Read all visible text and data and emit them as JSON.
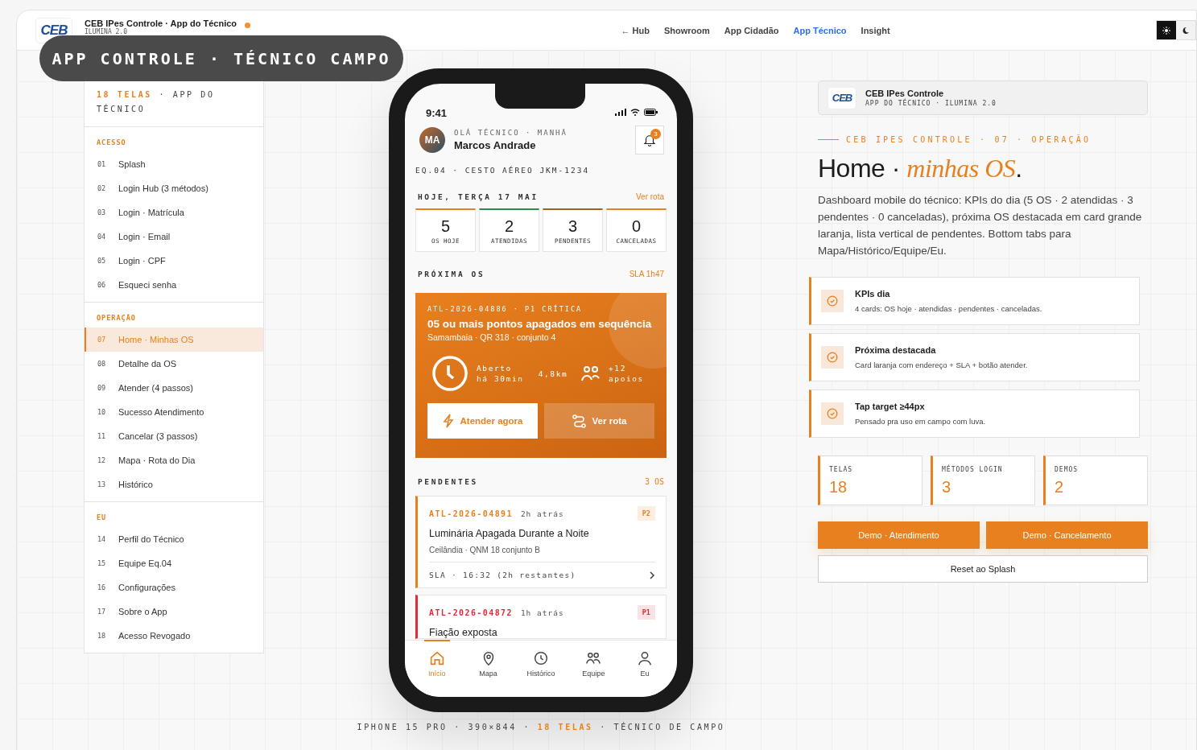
{
  "topbar": {
    "logo_text": "CEB",
    "title": "CEB IPes Controle · App do Técnico",
    "subtitle": "ILUMINA 2.0",
    "nav": [
      {
        "label": "← Hub",
        "selected": false
      },
      {
        "label": "Showroom",
        "selected": false
      },
      {
        "label": "App Cidadão",
        "selected": false
      },
      {
        "label": "App Técnico",
        "selected": true
      },
      {
        "label": "Insight",
        "selected": false
      }
    ],
    "theme_toggle": [
      {
        "kind": "light",
        "selected": true
      },
      {
        "kind": "dark",
        "selected": false
      }
    ]
  },
  "overlay_label": "APP CONTROLE · TÉCNICO CAMPO",
  "sidebar": {
    "heading": "**18 TELAS** · APP DO TÉCNICO",
    "groups": [
      {
        "title": "ACESSO",
        "items": [
          {
            "number": "01",
            "label": "Splash",
            "selected": false
          },
          {
            "number": "02",
            "label": "Login Hub (3 métodos)",
            "selected": false
          },
          {
            "number": "03",
            "label": "Login · Matrícula",
            "selected": false
          },
          {
            "number": "04",
            "label": "Login · Email",
            "selected": false
          },
          {
            "number": "05",
            "label": "Login · CPF",
            "selected": false
          },
          {
            "number": "06",
            "label": "Esqueci senha",
            "selected": false
          }
        ]
      },
      {
        "title": "OPERAÇÃO",
        "items": [
          {
            "number": "07",
            "label": "Home · Minhas OS",
            "selected": true
          },
          {
            "number": "08",
            "label": "Detalhe da OS",
            "selected": false
          },
          {
            "number": "09",
            "label": "Atender (4 passos)",
            "selected": false
          },
          {
            "number": "10",
            "label": "Sucesso Atendimento",
            "selected": false
          },
          {
            "number": "11",
            "label": "Cancelar (3 passos)",
            "selected": false
          },
          {
            "number": "12",
            "label": "Mapa · Rota do Dia",
            "selected": false
          },
          {
            "number": "13",
            "label": "Histórico",
            "selected": false
          }
        ]
      },
      {
        "title": "EU",
        "items": [
          {
            "number": "14",
            "label": "Perfil do Técnico",
            "selected": false
          },
          {
            "number": "15",
            "label": "Equipe Eq.04",
            "selected": false
          },
          {
            "number": "16",
            "label": "Configurações",
            "selected": false
          },
          {
            "number": "17",
            "label": "Sobre o App",
            "selected": false
          },
          {
            "number": "18",
            "label": "Acesso Revogado",
            "selected": false
          }
        ]
      }
    ]
  },
  "phone": {
    "time": "9:41",
    "avatar": "MA",
    "greeting": "OLÁ TÉCNICO · MANHÃ",
    "name": "Marcos Andrade",
    "notifications": "3",
    "team": "EQ.04 · CESTO AÉREO JKM-1234",
    "today": "HOJE, TERÇA 17 MAI",
    "today_link": "Ver rota",
    "kpis": [
      {
        "value": "5",
        "label": "OS HOJE",
        "color": "#e8801f"
      },
      {
        "value": "2",
        "label": "ATENDIDAS",
        "color": "#2f8a4e"
      },
      {
        "value": "3",
        "label": "PENDENTES",
        "color": "#9a6420"
      },
      {
        "value": "0",
        "label": "CANCELADAS",
        "color": "#e8801f"
      }
    ],
    "next_label": "PRÓXIMA OS",
    "next_sla": "SLA 1h47",
    "next": {
      "code": "ATL-2026-04886 · P1 CRÍTICA",
      "title": "05 ou mais pontos apagados em sequência",
      "address": "Samambaia · QR 318 · conjunto 4",
      "open": "Aberto há 30min",
      "distance": "4,8km",
      "support": "+12 apoios",
      "primary": "Atender agora",
      "secondary": "Ver rota"
    },
    "pending_label": "PENDENTES",
    "pending_count": "3 OS",
    "pending": [
      {
        "code": "ATL-2026-04891",
        "time": "2h atrás",
        "priority": "P2",
        "color": "#e8801f",
        "title": "Luminária Apagada Durante a Noite",
        "address": "Ceilândia · QNM 18 conjunto B",
        "sla": "SLA · 16:32 (2h restantes)"
      },
      {
        "code": "ATL-2026-04872",
        "time": "1h atrás",
        "priority": "P1",
        "color": "#d92d3a",
        "title": "Fiação exposta"
      }
    ],
    "tabs": [
      {
        "kind": "home",
        "label": "Início",
        "selected": true
      },
      {
        "kind": "map",
        "label": "Mapa",
        "selected": false
      },
      {
        "kind": "history",
        "label": "Histórico",
        "selected": false
      },
      {
        "kind": "team",
        "label": "Equipe",
        "selected": false
      },
      {
        "kind": "me",
        "label": "Eu",
        "selected": false
      }
    ]
  },
  "caption": "IPHONE 15 PRO · 390×844 · **18 TELAS** · TÉCNICO DE CAMPO",
  "detail": {
    "brand": {
      "logo_text": "CEB",
      "title": "CEB IPes Controle",
      "subtitle": "APP DO TÉCNICO · ILUMINA 2.0"
    },
    "eyebrow": "CEB IPES CONTROLE · 07 · OPERAÇÃO",
    "title": "Home · *minhas OS*.",
    "description": "Dashboard mobile do técnico: KPIs do dia (5 OS · 2 atendidas · 3 pendentes · 0 canceladas), próxima OS destacada em card grande laranja, lista vertical de pendentes. Bottom tabs para Mapa/Histórico/Equipe/Eu.",
    "features": [
      {
        "title": "KPIs dia",
        "text": "4 cards: OS hoje · atendidas · pendentes · canceladas."
      },
      {
        "title": "Próxima destacada",
        "text": "Card laranja com endereço + SLA + botão atender."
      },
      {
        "title": "Tap target ≥44px",
        "text": "Pensado pra uso em campo com luva."
      }
    ],
    "stats": [
      {
        "label": "TELAS",
        "value": "18"
      },
      {
        "label": "MÉTODOS LOGIN",
        "value": "3"
      },
      {
        "label": "DEMOS",
        "value": "2"
      }
    ],
    "buttons": [
      {
        "kind": "primary",
        "label": "Demo · Atendimento"
      },
      {
        "kind": "primary",
        "label": "Demo · Cancelamento"
      },
      {
        "kind": "secondary",
        "label": "Reset ao Splash"
      }
    ]
  }
}
